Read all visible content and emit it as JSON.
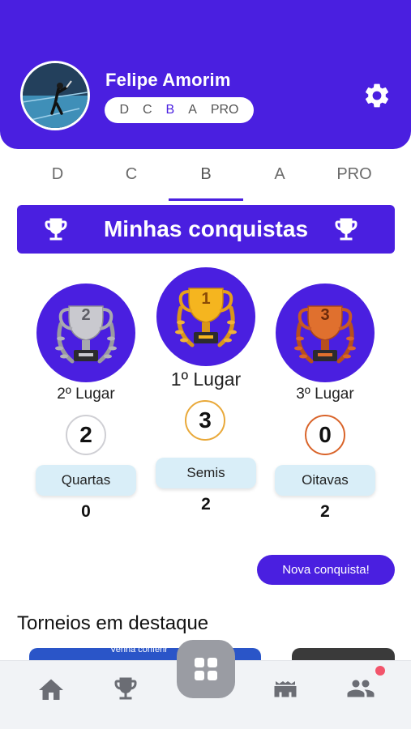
{
  "profile": {
    "name": "Felipe Amorim",
    "levels": [
      "D",
      "C",
      "B",
      "A",
      "PRO"
    ],
    "active_level": "B"
  },
  "tabs": [
    {
      "label": "D"
    },
    {
      "label": "C"
    },
    {
      "label": "B",
      "active": true
    },
    {
      "label": "A"
    },
    {
      "label": "PRO"
    }
  ],
  "conquistas": {
    "title": "Minhas conquistas",
    "podium": [
      {
        "place_label": "2º Lugar",
        "badge_text": "2",
        "count": "2",
        "round_label": "Quartas",
        "round_count": "0",
        "color": "#b9b9bf",
        "ring_color": "#cfcfd4"
      },
      {
        "place_label": "1º Lugar",
        "badge_text": "1",
        "count": "3",
        "round_label": "Semis",
        "round_count": "2",
        "color": "#f0a91a",
        "ring_color": "#e9a93a"
      },
      {
        "place_label": "3º Lugar",
        "badge_text": "3",
        "count": "0",
        "round_label": "Oitavas",
        "round_count": "2",
        "color": "#d9642a",
        "ring_color": "#d9642a"
      }
    ]
  },
  "actions": {
    "nova_conquista": "Nova conquista!"
  },
  "featured": {
    "title": "Torneios em destaque",
    "card_peek_text": "Venha conferir"
  },
  "colors": {
    "primary": "#4a1fe0",
    "pill_bg": "#d9eef8",
    "notification": "#f2546b"
  },
  "bottom_nav": {
    "items": [
      "home-icon",
      "trophy-icon",
      "grid-icon",
      "stadium-icon",
      "people-icon"
    ]
  }
}
